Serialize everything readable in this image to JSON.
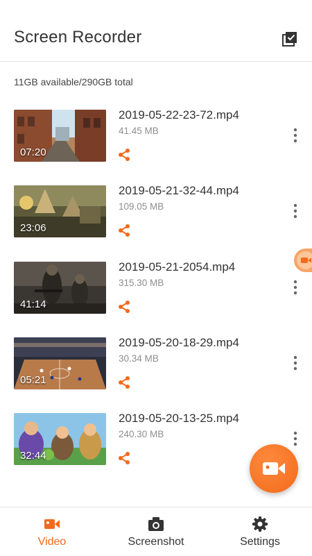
{
  "header": {
    "title": "Screen Recorder",
    "gallery_icon": "gallery-check-icon"
  },
  "storage": {
    "text": "11GB available/290GB total"
  },
  "videos": [
    {
      "name": "2019-05-22-23-72.mp4",
      "size": "41.45 MB",
      "duration": "07:20"
    },
    {
      "name": "2019-05-21-32-44.mp4",
      "size": "109.05 MB",
      "duration": "23:06"
    },
    {
      "name": "2019-05-21-2054.mp4",
      "size": "315.30 MB",
      "duration": "41:14"
    },
    {
      "name": "2019-05-20-18-29.mp4",
      "size": "30.34 MB",
      "duration": "05:21"
    },
    {
      "name": "2019-05-20-13-25.mp4",
      "size": "240.30 MB",
      "duration": "32:44"
    }
  ],
  "nav": {
    "video": "Video",
    "screenshot": "Screenshot",
    "settings": "Settings",
    "active": "video"
  },
  "colors": {
    "accent": "#f26a1b",
    "text": "#333333",
    "muted": "#8e8e8e"
  }
}
